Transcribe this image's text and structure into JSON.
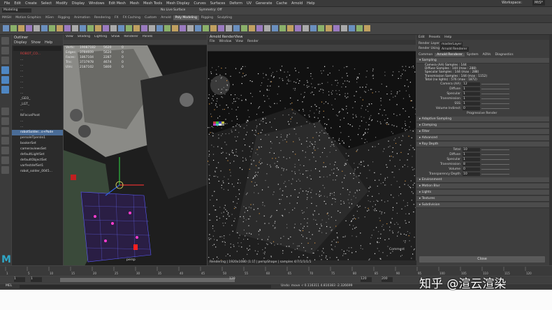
{
  "app": {
    "menus": [
      "File",
      "Edit",
      "Create",
      "Select",
      "Modify",
      "Display",
      "Windows",
      "Edit Mesh",
      "Mesh",
      "Mesh Tools",
      "Mesh Display",
      "Curves",
      "Surfaces",
      "Deform",
      "UV",
      "Generate",
      "Cache",
      "Arnold",
      "Help"
    ],
    "workspace_label": "Workspace:",
    "workspace_value": "MtS*",
    "mode": "Modeling",
    "live_surface": "No Live Surface",
    "symmetry": "Symmetry: Off"
  },
  "shelf_tabs": [
    "MASH",
    "Motion Graphics",
    "XGen",
    "Rigging",
    "Animation",
    "Rendering",
    "FX",
    "FX Caching",
    "Custom",
    "Arnold",
    "Poly Modeling",
    "Rigging",
    "Sculpting"
  ],
  "shelf_active": "Poly Modeling",
  "outliner": {
    "title": "Outliner",
    "menu": [
      "Display",
      "Show",
      "Help"
    ],
    "items": [
      {
        "label": "ROBOT_CO...",
        "style": "red"
      },
      {
        "label": "...",
        "style": ""
      },
      {
        "label": "...",
        "style": ""
      },
      {
        "label": "...",
        "style": ""
      },
      {
        "label": "...",
        "style": ""
      },
      {
        "label": "...",
        "style": ""
      },
      {
        "label": "...",
        "style": ""
      },
      {
        "label": "...",
        "style": ""
      },
      {
        "label": "_GEO_",
        "style": ""
      },
      {
        "label": "_LGT_",
        "style": ""
      },
      {
        "label": "...",
        "style": ""
      },
      {
        "label": "lbFocusPivot",
        "style": ""
      },
      {
        "label": "...",
        "style": ""
      },
      {
        "label": "...",
        "style": ""
      },
      {
        "label": "robotSolder...s+Pade",
        "style": "hl"
      },
      {
        "label": "persoleTpersle1",
        "style": ""
      },
      {
        "label": "bookerSet",
        "style": ""
      },
      {
        "label": "cameraviewsSet",
        "style": ""
      },
      {
        "label": "defaultLightSet",
        "style": ""
      },
      {
        "label": "defaultObjectSet",
        "style": ""
      },
      {
        "label": "varfestdefSet1",
        "style": ""
      },
      {
        "label": "robot_solder_0045...",
        "style": ""
      }
    ]
  },
  "viewport": {
    "menu": [
      "View",
      "Shading",
      "Lighting",
      "Show",
      "Renderer",
      "Panels"
    ],
    "hud": [
      {
        "k": "Verts:",
        "a": "19087182",
        "b": "5620",
        "c": "0"
      },
      {
        "k": "Edges:",
        "a": "3784609",
        "b": "5620",
        "c": "0"
      },
      {
        "k": "Faces:",
        "a": "1867104",
        "b": "2287",
        "c": "0"
      },
      {
        "k": "Tris:",
        "a": "3737978",
        "b": "4674",
        "c": "0"
      },
      {
        "k": "UVs:",
        "a": "2187102",
        "b": "5800",
        "c": "0"
      }
    ],
    "camera_label": "persp"
  },
  "renderview": {
    "title": "Arnold RenderView",
    "menu": [
      "File",
      "Window",
      "View",
      "Render"
    ],
    "status": "Rendering | 1920x1080 (1:1) | perspShape | samples 4/7/1/1/1/1"
  },
  "attribute_editor": {
    "menu": [
      "Edit",
      "Presets",
      "Help"
    ],
    "render_layer_label": "Render Layer",
    "render_layer_value": "masterLayer",
    "render_using_label": "Render Using",
    "render_using_value": "Arnold Renderer",
    "tabs": [
      "Common",
      "Arnold Renderer",
      "System",
      "AOVs",
      "Diagnostics"
    ],
    "sampling_header": "Sampling",
    "sampling_info": [
      "Camera (AA) Samples : 144",
      "Diffuse Samples : 144 (max : 288)",
      "Specular Samples : 144 (max : 288)",
      "Transmission Samples : 144 (max : 1152)",
      "Total (no lights) : 576 (max : 1872)"
    ],
    "sampling_rows": [
      {
        "label": "Camera (AA)",
        "value": "12"
      },
      {
        "label": "Diffuse",
        "value": "1"
      },
      {
        "label": "Specular",
        "value": "1"
      },
      {
        "label": "Transmission",
        "value": "1"
      },
      {
        "label": "SSS",
        "value": "1"
      },
      {
        "label": "Volume Indirect",
        "value": "0"
      }
    ],
    "progressive_label": "Progressive Render",
    "collapsed_sections": [
      "Adaptive Sampling",
      "Clamping",
      "Filter",
      "Advanced"
    ],
    "ray_depth_header": "Ray Depth",
    "ray_depth_rows": [
      {
        "label": "Total",
        "value": "10"
      },
      {
        "label": "Diffuse",
        "value": "1"
      },
      {
        "label": "Specular",
        "value": "1"
      },
      {
        "label": "Transmission",
        "value": "8"
      },
      {
        "label": "Volume",
        "value": "0"
      },
      {
        "label": "Transparency Depth",
        "value": "10"
      }
    ],
    "more_sections": [
      "Environment",
      "Motion Blur",
      "Lights",
      "Textures",
      "Subdivision"
    ],
    "close_label": "Close"
  },
  "timeline": {
    "ticks": [
      "1",
      "5",
      "10",
      "15",
      "20",
      "25",
      "30",
      "35",
      "40",
      "45",
      "50",
      "55",
      "60",
      "65",
      "70",
      "75",
      "80",
      "85",
      "90",
      "95",
      "100",
      "105",
      "110",
      "115",
      "120"
    ],
    "range_start": "1",
    "range_end": "120",
    "range_end2": "120",
    "range_max": "200"
  },
  "command": {
    "lang": "MEL",
    "result": "Undo: move -r 0.116311 4.810383 -2.326699"
  },
  "watermark": "知乎 @渲云渲染",
  "colors": {
    "accent": "#4e86c2",
    "selection": "#4a6c97",
    "panel": "#3e3e3e"
  }
}
